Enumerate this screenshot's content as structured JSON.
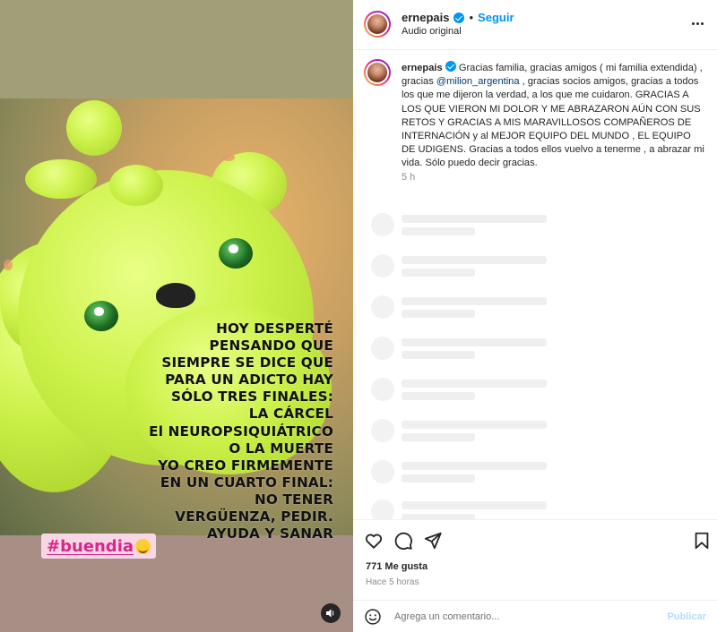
{
  "media": {
    "caption_lines": [
      "HOY DESPERTÉ",
      "PENSANDO QUE",
      "SIEMPRE SE DICE QUE",
      "PARA UN ADICTO HAY",
      "SÓLO TRES FINALES:",
      "LA CÁRCEL",
      "El NEUROPSIQUIÁTRICO",
      "O LA MUERTE",
      "YO CREO FIRMEMENTE",
      "EN UN CUARTO FINAL:",
      "NO TENER",
      "VERGÜENZA, PEDIR.",
      "AYUDA Y SANAR"
    ],
    "hashtag": "#buendia",
    "volume_icon": "speaker-icon"
  },
  "header": {
    "username": "ernepais",
    "separator": "•",
    "follow_label": "Seguir",
    "audio_label": "Audio original"
  },
  "caption": {
    "username": "ernepais",
    "text_before_mention": "Gracias familia, gracias amigos ( mi familia extendida) , gracias ",
    "mention": "@milion_argentina",
    "text_after_mention": " , gracias socios amigos, gracias a todos los que me dijeron la verdad, a los que me cuidaron. GRACIAS A LOS QUE VIERON MI DOLOR Y ME ABRAZARON AÚN CON SUS RETOS Y GRACIAS A MIS MARAVILLOSOS COMPAÑEROS DE INTERNACIÓN y al MEJOR EQUIPO DEL MUNDO , EL EQUIPO DE UDIGENS. Gracias a todos ellos vuelvo a tenerme , a abrazar mi vida. Sólo puedo decir gracias.",
    "time": "5 h"
  },
  "actions": {
    "likes": "771 Me gusta",
    "time_ago": "Hace 5 horas"
  },
  "comment_bar": {
    "placeholder": "Agrega un comentario...",
    "publish_label": "Publicar"
  },
  "colors": {
    "accent": "#0095f6",
    "mention": "#00376b",
    "muted": "#8e8e8e",
    "hashtag": "#d8278a"
  }
}
